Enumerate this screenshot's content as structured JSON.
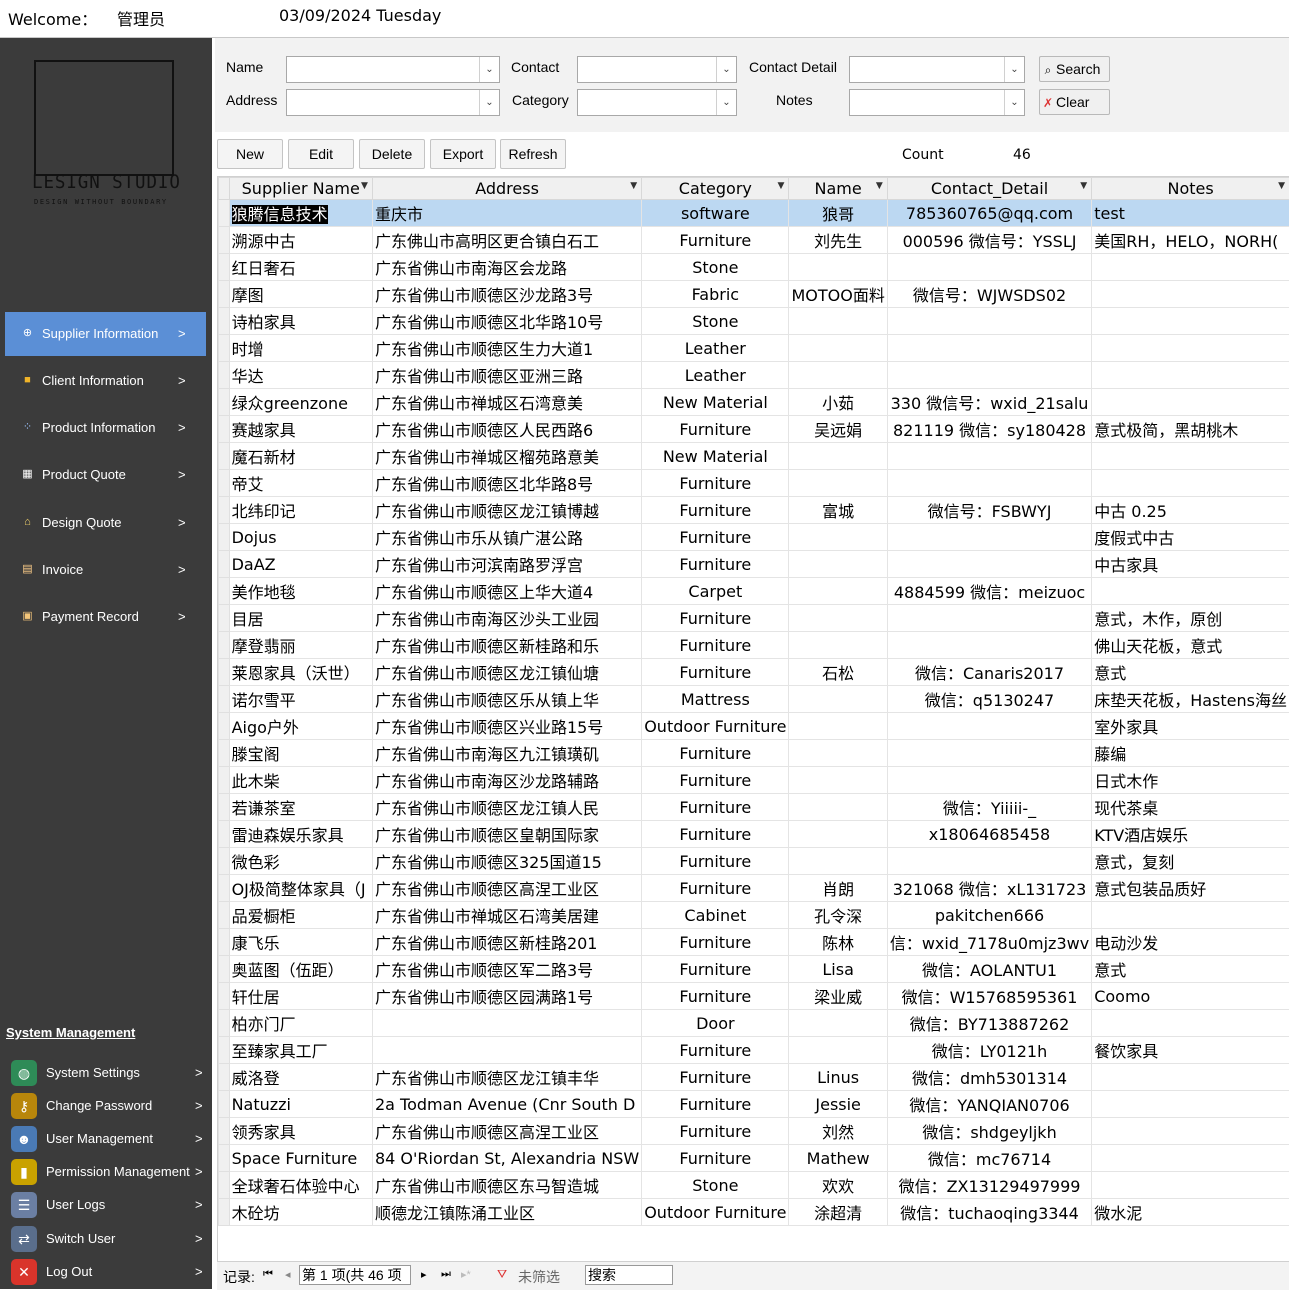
{
  "header": {
    "welcome_label": "Welcome：",
    "user": "管理员",
    "date": "03/09/2024 Tuesday"
  },
  "logo": {
    "text": "LESIGN  STUDIO",
    "tagline": "DESIGN  WITHOUT  BOUNDARY"
  },
  "nav": [
    {
      "label": "Supplier Information",
      "arrow": ">",
      "icon": "globe-icon",
      "active": true
    },
    {
      "label": "Client Information",
      "arrow": ">",
      "icon": "folder-icon",
      "active": false
    },
    {
      "label": "Product Information",
      "arrow": ">",
      "icon": "hierarchy-icon",
      "active": false
    },
    {
      "label": "Product Quote",
      "arrow": ">",
      "icon": "table-icon",
      "active": false
    },
    {
      "label": "Design Quote",
      "arrow": ">",
      "icon": "home-icon",
      "active": false
    },
    {
      "label": "Invoice",
      "arrow": ">",
      "icon": "invoice-icon",
      "active": false
    },
    {
      "label": "Payment  Record",
      "arrow": ">",
      "icon": "clipboard-icon",
      "active": false
    }
  ],
  "system": {
    "title": "System Management",
    "items": [
      {
        "label": "System Settings",
        "arrow": ">",
        "icon": "globe-icon",
        "color": "#2e8b57"
      },
      {
        "label": "Change Password",
        "arrow": ">",
        "icon": "key-users-icon",
        "color": "#b8860b"
      },
      {
        "label": "User Management",
        "arrow": ">",
        "icon": "users-icon",
        "color": "#4a7ab5"
      },
      {
        "label": "Permission Management",
        "arrow": ">",
        "icon": "lock-icon",
        "color": "#c9a200"
      },
      {
        "label": "User Logs",
        "arrow": ">",
        "icon": "user-log-icon",
        "color": "#6b7fa3"
      },
      {
        "label": "Switch User",
        "arrow": ">",
        "icon": "switch-user-icon",
        "color": "#5a6e8c"
      },
      {
        "label": "Log Out",
        "arrow": ">",
        "icon": "logout-icon",
        "color": "#d9342b"
      }
    ]
  },
  "filters": {
    "name_label": "Name",
    "address_label": "Address",
    "contact_label": "Contact",
    "category_label": "Category",
    "contact_detail_label": "Contact Detail",
    "notes_label": "Notes",
    "name_value": "",
    "address_value": "",
    "contact_value": "",
    "category_value": "",
    "contact_detail_value": "",
    "notes_value": "",
    "search_label": "Search",
    "clear_label": "Clear"
  },
  "toolbar": {
    "new_label": "New",
    "edit_label": "Edit",
    "delete_label": "Delete",
    "export_label": "Export",
    "refresh_label": "Refresh",
    "count_label": "Count",
    "count_value": "46"
  },
  "grid": {
    "columns": [
      "Supplier Name",
      "Address",
      "Category",
      "Name",
      "Contact_Detail",
      "Notes"
    ],
    "rows": [
      [
        "狼腾信息技术",
        "重庆市",
        "software",
        "狼哥",
        "785360765@qq.com",
        "test"
      ],
      [
        "溯源中古",
        "广东佛山市高明区更合镇白石工",
        "Furniture",
        "刘先生",
        "000596 微信号：YSSLJ",
        "美国RH，HELO，NORH("
      ],
      [
        "红日奢石",
        "广东省佛山市南海区会龙路",
        "Stone",
        "",
        "",
        ""
      ],
      [
        "摩图",
        "广东省佛山市顺德区沙龙路3号",
        "Fabric",
        "MOTOO面料",
        "微信号：WJWSDS02",
        ""
      ],
      [
        "诗柏家具",
        "广东省佛山市顺德区北华路10号",
        "Stone",
        "",
        "",
        ""
      ],
      [
        "时增",
        "广东省佛山市顺德区生力大道1",
        "Leather",
        "",
        "",
        ""
      ],
      [
        "华达",
        "广东省佛山市顺德区亚洲三路",
        "Leather",
        "",
        "",
        ""
      ],
      [
        "绿众greenzone",
        "广东省佛山市禅城区石湾意美",
        "New Material",
        "小茹",
        "330 微信号：wxid_21salu",
        ""
      ],
      [
        "赛越家具",
        "广东省佛山市顺德区人民西路6",
        "Furniture",
        "吴远娟",
        "821119 微信：sy180428",
        "意式极简，黑胡桃木"
      ],
      [
        "魔石新材",
        "广东省佛山市禅城区榴苑路意美",
        "New Material",
        "",
        "",
        ""
      ],
      [
        "帝艾",
        "广东省佛山市顺德区北华路8号",
        "Furniture",
        "",
        "",
        ""
      ],
      [
        "北纬印记",
        "广东省佛山市顺德区龙江镇博越",
        "Furniture",
        "富城",
        "微信号：FSBWYJ",
        "中古 0.25"
      ],
      [
        "Dojus",
        "广东省佛山市乐从镇广湛公路",
        "Furniture",
        "",
        "",
        "度假式中古"
      ],
      [
        "DaAZ",
        "广东省佛山市河滨南路罗浮宫",
        "Furniture",
        "",
        "",
        "中古家具"
      ],
      [
        "美作地毯",
        "广东省佛山市顺德区上华大道4",
        "Carpet",
        "",
        "4884599 微信：meizuoc",
        ""
      ],
      [
        "目居",
        "广东省佛山市南海区沙头工业园",
        "Furniture",
        "",
        "",
        "意式，木作，原创"
      ],
      [
        "摩登翡丽",
        "广东省佛山市顺德区新桂路和乐",
        "Furniture",
        "",
        "",
        "佛山天花板，意式"
      ],
      [
        "莱恩家具（沃世）",
        "广东省佛山市顺德区龙江镇仙塘",
        "Furniture",
        "石松",
        "微信：Canaris2017",
        "意式"
      ],
      [
        "诺尔雪平",
        "广东省佛山市顺德区乐从镇上华",
        "Mattress",
        "",
        "微信：q5130247",
        "床垫天花板，Hastens海丝"
      ],
      [
        "Aigo户外",
        "广东省佛山市顺德区兴业路15号",
        "Outdoor Furniture",
        "",
        "",
        "室外家具"
      ],
      [
        "滕宝阁",
        "广东省佛山市南海区九江镇璜矶",
        "Furniture",
        "",
        "",
        "藤编"
      ],
      [
        "此木柴",
        "广东省佛山市南海区沙龙路辅路",
        "Furniture",
        "",
        "",
        "日式木作"
      ],
      [
        "若谦茶室",
        "广东省佛山市顺德区龙江镇人民",
        "Furniture",
        "",
        "微信：Yiiiii-_",
        "现代茶桌"
      ],
      [
        "雷迪森娱乐家具",
        "广东省佛山市顺德区皇朝国际家",
        "Furniture",
        "",
        "x18064685458",
        "KTV酒店娱乐"
      ],
      [
        "微色彩",
        "广东省佛山市顺德区325国道15",
        "Furniture",
        "",
        "",
        "意式，复刻"
      ],
      [
        "OJ极简整体家具（J",
        "广东省佛山市顺德区高涅工业区",
        "Furniture",
        "肖朗",
        "321068 微信：xL131723",
        "意式包装品质好"
      ],
      [
        "品爱橱柜",
        "广东省佛山市禅城区石湾美居建",
        "Cabinet",
        "孔令深",
        "pakitchen666",
        ""
      ],
      [
        "康飞乐",
        "广东省佛山市顺德区新桂路201",
        "Furniture",
        "陈林",
        "信：wxid_7178u0mjz3wv",
        "电动沙发"
      ],
      [
        "奥蓝图（伍距）",
        "广东省佛山市顺德区军二路3号",
        "Furniture",
        "Lisa",
        "微信：AOLANTU1",
        "意式"
      ],
      [
        "轩仕居",
        "广东省佛山市顺德区园满路1号",
        "Furniture",
        "梁业威",
        "微信：W15768595361",
        "Coomo"
      ],
      [
        "柏亦门厂",
        "",
        "Door",
        "",
        "微信：BY713887262",
        ""
      ],
      [
        "至臻家具工厂",
        "",
        "Furniture",
        "",
        "微信：LY0121h",
        "餐饮家具"
      ],
      [
        "威洛登",
        "广东省佛山市顺德区龙江镇丰华",
        "Furniture",
        "Linus",
        "微信：dmh5301314",
        ""
      ],
      [
        "Natuzzi",
        "2a Todman Avenue (Cnr South D",
        "Furniture",
        "Jessie",
        "微信：YANQIAN0706",
        ""
      ],
      [
        "领秀家具",
        "广东省佛山市顺德区高涅工业区",
        "Furniture",
        "刘然",
        "微信：shdgeyljkh",
        ""
      ],
      [
        "Space Furniture",
        "84 O'Riordan St, Alexandria NSW",
        "Furniture",
        "Mathew",
        "微信：mc76714",
        ""
      ],
      [
        "全球奢石体验中心",
        "广东省佛山市顺德区东马智造城",
        "Stone",
        "欢欢",
        "微信：ZX13129497999",
        ""
      ],
      [
        "木砼坊",
        "顺德龙江镇陈涌工业区",
        "Outdoor Furniture",
        "涂超清",
        "微信：tuchaoqing3344",
        "微水泥"
      ]
    ]
  },
  "status": {
    "records_label": "记录:",
    "page_text": "第 1 项(共 46 项",
    "filter_label": "未筛选",
    "search_label": "搜索"
  }
}
